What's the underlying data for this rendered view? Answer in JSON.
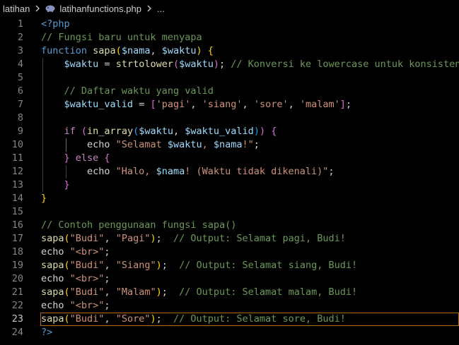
{
  "breadcrumb": {
    "folder": "latihan",
    "file": "latihanfunctions.php",
    "ellipsis": "...",
    "file_icon": "php-elephant-icon"
  },
  "editor": {
    "active_line": 23,
    "lines": [
      {
        "n": "1",
        "tokens": [
          {
            "t": "<?php",
            "c": "tag"
          }
        ]
      },
      {
        "n": "2",
        "tokens": [
          {
            "t": "// Fungsi baru untuk menyapa",
            "c": "cmt"
          }
        ]
      },
      {
        "n": "3",
        "tokens": [
          {
            "t": "function ",
            "c": "kw"
          },
          {
            "t": "sapa",
            "c": "fn"
          },
          {
            "t": "(",
            "c": "br1"
          },
          {
            "t": "$nama",
            "c": "var"
          },
          {
            "t": ", ",
            "c": "txt"
          },
          {
            "t": "$waktu",
            "c": "var"
          },
          {
            "t": ") ",
            "c": "br1"
          },
          {
            "t": "{",
            "c": "br1"
          }
        ]
      },
      {
        "n": "4",
        "tokens": [
          {
            "t": "    ",
            "c": "txt"
          },
          {
            "t": "$waktu",
            "c": "var"
          },
          {
            "t": " = ",
            "c": "txt"
          },
          {
            "t": "strtolower",
            "c": "fn"
          },
          {
            "t": "(",
            "c": "br2"
          },
          {
            "t": "$waktu",
            "c": "var"
          },
          {
            "t": ")",
            "c": "br2"
          },
          {
            "t": "; ",
            "c": "txt"
          },
          {
            "t": "// Konversi ke lowercase untuk konsistensi",
            "c": "cmt"
          }
        ]
      },
      {
        "n": "5",
        "tokens": []
      },
      {
        "n": "6",
        "tokens": [
          {
            "t": "    ",
            "c": "txt"
          },
          {
            "t": "// Daftar waktu yang valid",
            "c": "cmt"
          }
        ]
      },
      {
        "n": "7",
        "tokens": [
          {
            "t": "    ",
            "c": "txt"
          },
          {
            "t": "$waktu_valid",
            "c": "var"
          },
          {
            "t": " = ",
            "c": "txt"
          },
          {
            "t": "[",
            "c": "br2"
          },
          {
            "t": "'pagi'",
            "c": "str"
          },
          {
            "t": ", ",
            "c": "txt"
          },
          {
            "t": "'siang'",
            "c": "str"
          },
          {
            "t": ", ",
            "c": "txt"
          },
          {
            "t": "'sore'",
            "c": "str"
          },
          {
            "t": ", ",
            "c": "txt"
          },
          {
            "t": "'malam'",
            "c": "str"
          },
          {
            "t": "]",
            "c": "br2"
          },
          {
            "t": ";",
            "c": "txt"
          }
        ]
      },
      {
        "n": "8",
        "tokens": []
      },
      {
        "n": "9",
        "tokens": [
          {
            "t": "    ",
            "c": "txt"
          },
          {
            "t": "if ",
            "c": "ctl"
          },
          {
            "t": "(",
            "c": "br2"
          },
          {
            "t": "in_array",
            "c": "fn"
          },
          {
            "t": "(",
            "c": "br3"
          },
          {
            "t": "$waktu",
            "c": "var"
          },
          {
            "t": ", ",
            "c": "txt"
          },
          {
            "t": "$waktu_valid",
            "c": "var"
          },
          {
            "t": ")",
            "c": "br3"
          },
          {
            "t": ") ",
            "c": "br2"
          },
          {
            "t": "{",
            "c": "br2"
          }
        ]
      },
      {
        "n": "10",
        "tokens": [
          {
            "t": "        ",
            "c": "txt"
          },
          {
            "t": "echo ",
            "c": "txt"
          },
          {
            "t": "\"Selamat ",
            "c": "str"
          },
          {
            "t": "$waktu",
            "c": "var"
          },
          {
            "t": ", ",
            "c": "str"
          },
          {
            "t": "$nama",
            "c": "var"
          },
          {
            "t": "!\"",
            "c": "str"
          },
          {
            "t": ";",
            "c": "txt"
          }
        ]
      },
      {
        "n": "11",
        "tokens": [
          {
            "t": "    ",
            "c": "txt"
          },
          {
            "t": "} ",
            "c": "br2"
          },
          {
            "t": "else ",
            "c": "ctl"
          },
          {
            "t": "{",
            "c": "br2"
          }
        ]
      },
      {
        "n": "12",
        "tokens": [
          {
            "t": "        ",
            "c": "txt"
          },
          {
            "t": "echo ",
            "c": "txt"
          },
          {
            "t": "\"Halo, ",
            "c": "str"
          },
          {
            "t": "$nama",
            "c": "var"
          },
          {
            "t": "! (Waktu tidak dikenali)\"",
            "c": "str"
          },
          {
            "t": ";",
            "c": "txt"
          }
        ]
      },
      {
        "n": "13",
        "tokens": [
          {
            "t": "    ",
            "c": "txt"
          },
          {
            "t": "}",
            "c": "br2"
          }
        ]
      },
      {
        "n": "14",
        "tokens": [
          {
            "t": "}",
            "c": "br1"
          }
        ]
      },
      {
        "n": "15",
        "tokens": []
      },
      {
        "n": "16",
        "tokens": [
          {
            "t": "// Contoh penggunaan fungsi sapa()",
            "c": "cmt"
          }
        ]
      },
      {
        "n": "17",
        "tokens": [
          {
            "t": "sapa",
            "c": "fn"
          },
          {
            "t": "(",
            "c": "br1"
          },
          {
            "t": "\"Budi\"",
            "c": "str"
          },
          {
            "t": ", ",
            "c": "txt"
          },
          {
            "t": "\"Pagi\"",
            "c": "str"
          },
          {
            "t": ")",
            "c": "br1"
          },
          {
            "t": ";  ",
            "c": "txt"
          },
          {
            "t": "// Output: Selamat pagi, Budi!",
            "c": "cmt"
          }
        ]
      },
      {
        "n": "18",
        "tokens": [
          {
            "t": "echo ",
            "c": "txt"
          },
          {
            "t": "\"<br>\"",
            "c": "str"
          },
          {
            "t": ";",
            "c": "txt"
          }
        ]
      },
      {
        "n": "19",
        "tokens": [
          {
            "t": "sapa",
            "c": "fn"
          },
          {
            "t": "(",
            "c": "br1"
          },
          {
            "t": "\"Budi\"",
            "c": "str"
          },
          {
            "t": ", ",
            "c": "txt"
          },
          {
            "t": "\"Siang\"",
            "c": "str"
          },
          {
            "t": ")",
            "c": "br1"
          },
          {
            "t": ";  ",
            "c": "txt"
          },
          {
            "t": "// Output: Selamat siang, Budi!",
            "c": "cmt"
          }
        ]
      },
      {
        "n": "20",
        "tokens": [
          {
            "t": "echo ",
            "c": "txt"
          },
          {
            "t": "\"<br>\"",
            "c": "str"
          },
          {
            "t": ";",
            "c": "txt"
          }
        ]
      },
      {
        "n": "21",
        "tokens": [
          {
            "t": "sapa",
            "c": "fn"
          },
          {
            "t": "(",
            "c": "br1"
          },
          {
            "t": "\"Budi\"",
            "c": "str"
          },
          {
            "t": ", ",
            "c": "txt"
          },
          {
            "t": "\"Malam\"",
            "c": "str"
          },
          {
            "t": ")",
            "c": "br1"
          },
          {
            "t": ";  ",
            "c": "txt"
          },
          {
            "t": "// Output: Selamat malam, Budi!",
            "c": "cmt"
          }
        ]
      },
      {
        "n": "22",
        "tokens": [
          {
            "t": "echo ",
            "c": "txt"
          },
          {
            "t": "\"<br>\"",
            "c": "str"
          },
          {
            "t": ";",
            "c": "txt"
          }
        ]
      },
      {
        "n": "23",
        "tokens": [
          {
            "t": "sapa",
            "c": "fn"
          },
          {
            "t": "(",
            "c": "br1"
          },
          {
            "t": "\"Budi\"",
            "c": "str"
          },
          {
            "t": ", ",
            "c": "txt"
          },
          {
            "t": "\"Sore\"",
            "c": "str"
          },
          {
            "t": ")",
            "c": "br1"
          },
          {
            "t": ";  ",
            "c": "txt"
          },
          {
            "t": "// Output: Selamat sore, Budi!",
            "c": "cmt"
          }
        ]
      },
      {
        "n": "24",
        "tokens": [
          {
            "t": "?>",
            "c": "tag"
          }
        ]
      }
    ]
  },
  "colors": {
    "background": "#000000",
    "line_number": "#858585",
    "active_line_border": "#ad6a12",
    "keyword": "#569cd6",
    "control": "#c586c0",
    "function": "#dcdcaa",
    "variable": "#9cdcfe",
    "string": "#ce9178",
    "comment": "#6a9955",
    "bracket_1": "#ffd700",
    "bracket_2": "#da70d6",
    "bracket_3": "#179fff"
  }
}
